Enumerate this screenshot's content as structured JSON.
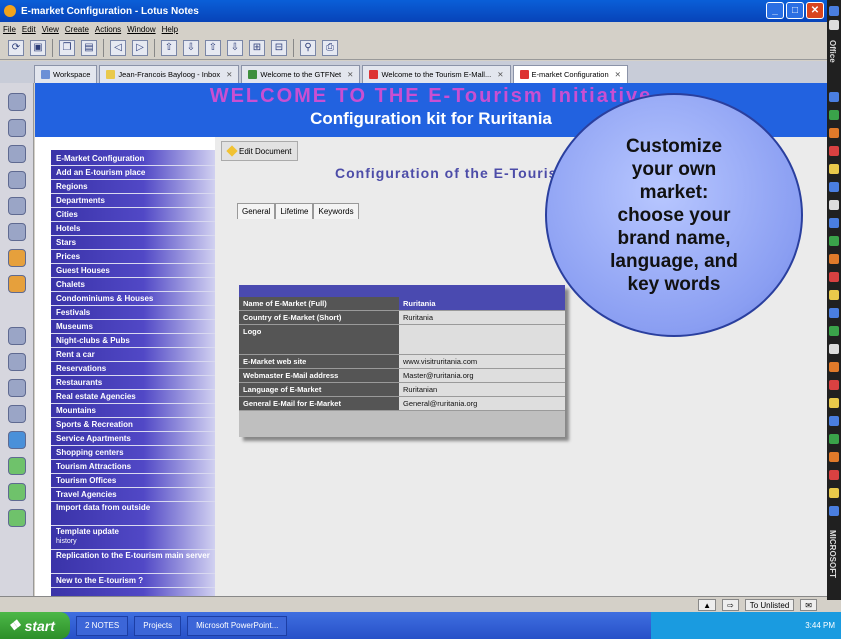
{
  "window": {
    "title": "E-market Configuration - Lotus Notes"
  },
  "menubar": {
    "items": [
      "File",
      "Edit",
      "View",
      "Create",
      "Actions",
      "Window",
      "Help"
    ]
  },
  "tabs": [
    {
      "label": "Workspace",
      "active": false
    },
    {
      "label": "Jean-Francois Bayloog - Inbox",
      "active": false
    },
    {
      "label": "Welcome to the GTFNet",
      "active": false
    },
    {
      "label": "Welcome to the Tourism E-Mall...",
      "active": false
    },
    {
      "label": "E-market Configuration",
      "active": true
    }
  ],
  "banner": {
    "title": "WELCOME TO THE E-Tourism Initiative",
    "subtitle": "Configuration kit for  Ruritania"
  },
  "nav": {
    "items": [
      {
        "label": "E-Market Configuration"
      },
      {
        "label": "Add an E-tourism place"
      },
      {
        "label": "Regions"
      },
      {
        "label": "Departments"
      },
      {
        "label": "Cities"
      },
      {
        "label": "Hotels"
      },
      {
        "label": "Stars"
      },
      {
        "label": "Prices"
      },
      {
        "label": "Guest Houses"
      },
      {
        "label": "Chalets"
      },
      {
        "label": "Condominiums & Houses"
      },
      {
        "label": "Festivals"
      },
      {
        "label": "Museums"
      },
      {
        "label": "Night-clubs & Pubs"
      },
      {
        "label": "Rent a car"
      },
      {
        "label": "Reservations"
      },
      {
        "label": "Restaurants"
      },
      {
        "label": "Real estate Agencies"
      },
      {
        "label": "Mountains"
      },
      {
        "label": "Sports & Recreation"
      },
      {
        "label": "Service Apartments"
      },
      {
        "label": "Shopping centers"
      },
      {
        "label": "Tourism Attractions"
      },
      {
        "label": "Tourism Offices"
      },
      {
        "label": "Travel Agencies"
      }
    ],
    "import": "Import data from outside",
    "template": {
      "label": "Template update",
      "sub": "history"
    },
    "replication": "Replication to the E-tourism main server",
    "newto": "New to the E-tourism ?"
  },
  "edit_button": "Edit Document",
  "config": {
    "title": "Configuration of the E-Tourism Initiative",
    "tabs": [
      "General",
      "Lifetime",
      "Keywords"
    ],
    "rows": [
      {
        "label": "Name of E-Market (Full)",
        "value": "Ruritania"
      },
      {
        "label": "Country of E-Market (Short)",
        "value": "Ruritania"
      },
      {
        "label": "Logo",
        "value": ""
      },
      {
        "label": "E-Market web site",
        "value": "www.visitruritania.com"
      },
      {
        "label": "Webmaster E-Mail address",
        "value": "Master@ruritania.org"
      },
      {
        "label": "Language of E-Market",
        "value": "Ruritanian"
      },
      {
        "label": "General E-Mail for E-Market",
        "value": "General@ruritania.org"
      }
    ]
  },
  "callout": {
    "lines": [
      "Customize",
      "your own",
      "market:",
      "choose your",
      "brand name,",
      "language, and",
      "key words"
    ]
  },
  "statusbar": {
    "location": "To Unlisted"
  },
  "taskbar": {
    "start": "start",
    "buttons": [
      "2 NOTES",
      "Projects",
      "Microsoft PowerPoint..."
    ],
    "clock": "3:44 PM"
  },
  "side_toolbar": {
    "label": "Office",
    "label2": "MICROSOFT"
  },
  "colors": {
    "banner": "#2262e0",
    "nav": "#3a33a8",
    "accent_title": "#4c4ca8",
    "callout": "#8a9ef2"
  }
}
